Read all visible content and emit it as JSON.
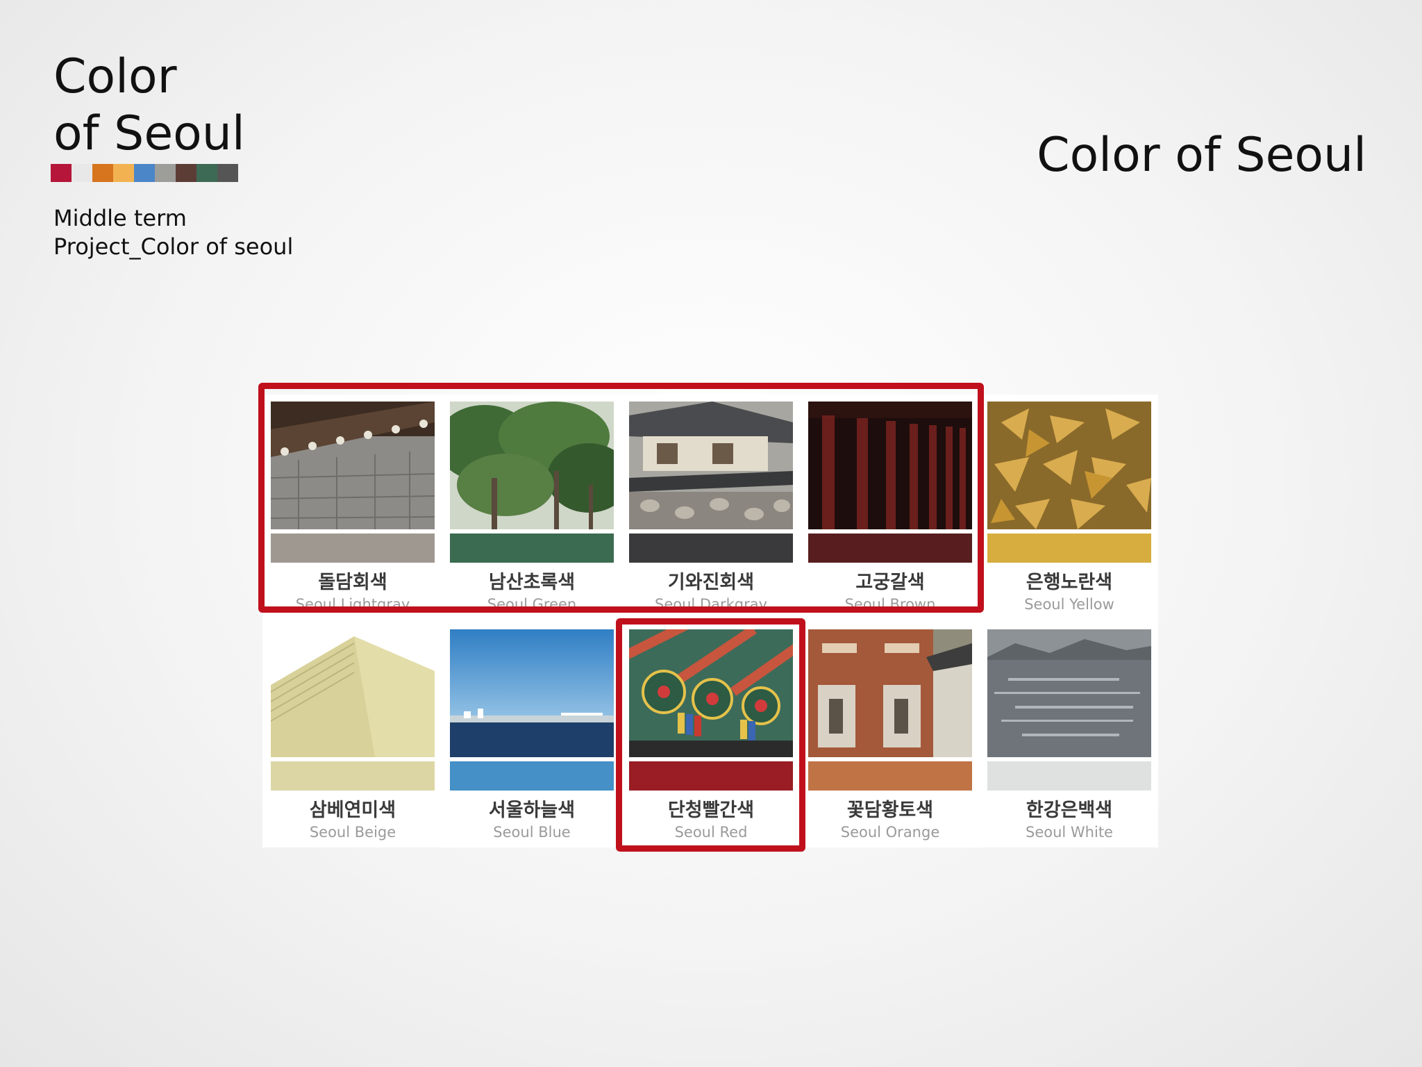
{
  "header": {
    "logo_title": "Color\nof Seoul",
    "logo_colors": [
      "#b5163a",
      "#e8e8e8",
      "#d7751e",
      "#f2b252",
      "#4a86c8",
      "#9d9d9a",
      "#5c3d36",
      "#3d6a55",
      "#555555"
    ],
    "subtitle": "Middle term\nProject_Color of seoul",
    "slide_title": "Color of Seoul"
  },
  "palette": {
    "colors": [
      {
        "korean": "돌담회색",
        "english": "Seoul Lightgray",
        "swatch": "#9e9891",
        "photo": "stone-wall"
      },
      {
        "korean": "남산초록색",
        "english": "Seoul Green",
        "swatch": "#3b6b50",
        "photo": "pine-trees"
      },
      {
        "korean": "기와진회색",
        "english": "Seoul Darkgray",
        "swatch": "#3a3a3c",
        "photo": "hanok-roof"
      },
      {
        "korean": "고궁갈색",
        "english": "Seoul Brown",
        "swatch": "#581e1f",
        "photo": "palace-columns"
      },
      {
        "korean": "은행노란색",
        "english": "Seoul Yellow",
        "swatch": "#d6ad3e",
        "photo": "ginkgo-leaves"
      },
      {
        "korean": "삼베연미색",
        "english": "Seoul Beige",
        "swatch": "#dcd6a5",
        "photo": "hemp-paper"
      },
      {
        "korean": "서울하늘색",
        "english": "Seoul Blue",
        "swatch": "#4490c7",
        "photo": "han-river-sky"
      },
      {
        "korean": "단청빨간색",
        "english": "Seoul Red",
        "swatch": "#9a1c24",
        "photo": "dancheong"
      },
      {
        "korean": "꽃담황토색",
        "english": "Seoul Orange",
        "swatch": "#c07344",
        "photo": "flower-wall"
      },
      {
        "korean": "한강은백색",
        "english": "Seoul White",
        "swatch": "#dfe0e0",
        "photo": "river-water"
      }
    ],
    "highlight_color": "#c0101c"
  }
}
